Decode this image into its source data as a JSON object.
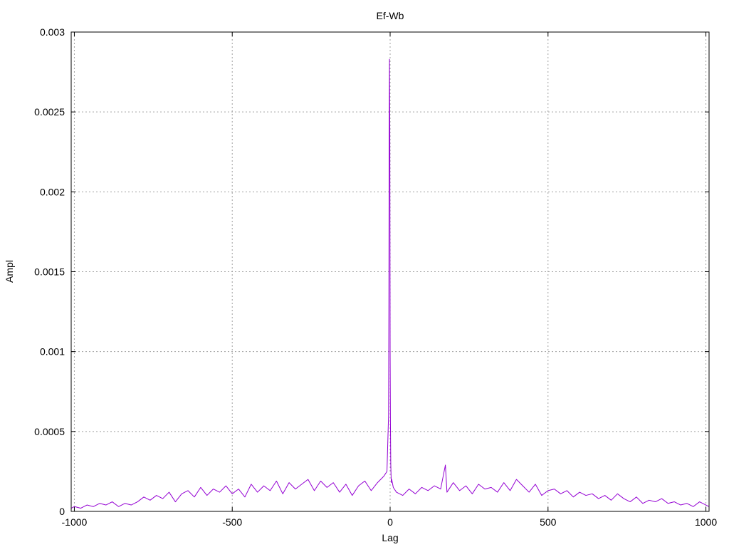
{
  "chart_data": {
    "type": "line",
    "title": "Ef-Wb",
    "xlabel": "Lag",
    "ylabel": "Ampl",
    "xlim": [
      -1010,
      1010
    ],
    "ylim": [
      0,
      0.003
    ],
    "x_ticks": [
      -1000,
      -500,
      0,
      500,
      1000
    ],
    "x_tick_labels": [
      "-1000",
      "-500",
      "0",
      "500",
      "1000"
    ],
    "y_ticks": [
      0,
      0.0005,
      0.001,
      0.0015,
      0.002,
      0.0025,
      0.003
    ],
    "y_tick_labels": [
      "0",
      "0.0005",
      "0.001",
      "0.0015",
      "0.002",
      "0.0025",
      "0.003"
    ],
    "grid": true,
    "series": [
      {
        "color": "#9400d3",
        "x": [
          -1010,
          -1000,
          -980,
          -960,
          -940,
          -920,
          -900,
          -880,
          -860,
          -840,
          -820,
          -800,
          -780,
          -760,
          -740,
          -720,
          -700,
          -680,
          -660,
          -640,
          -620,
          -600,
          -580,
          -560,
          -540,
          -520,
          -500,
          -480,
          -460,
          -440,
          -420,
          -400,
          -380,
          -360,
          -340,
          -320,
          -300,
          -280,
          -260,
          -240,
          -220,
          -200,
          -180,
          -160,
          -140,
          -120,
          -100,
          -80,
          -60,
          -40,
          -20,
          -10,
          -5,
          -4,
          -3,
          -2,
          -1,
          0,
          1,
          2,
          3,
          4,
          5,
          10,
          20,
          40,
          60,
          80,
          100,
          120,
          140,
          160,
          175,
          180,
          200,
          220,
          240,
          260,
          280,
          300,
          320,
          340,
          360,
          380,
          400,
          420,
          440,
          460,
          480,
          500,
          520,
          540,
          560,
          580,
          600,
          620,
          640,
          660,
          680,
          700,
          720,
          740,
          760,
          780,
          800,
          820,
          840,
          860,
          880,
          900,
          920,
          940,
          960,
          980,
          1000,
          1010
        ],
        "y": [
          2e-05,
          3e-05,
          2e-05,
          4e-05,
          3e-05,
          5e-05,
          4e-05,
          6e-05,
          3e-05,
          5e-05,
          4e-05,
          6e-05,
          9e-05,
          7e-05,
          0.0001,
          8e-05,
          0.00012,
          6e-05,
          0.00011,
          0.00013,
          9e-05,
          0.00015,
          0.0001,
          0.00014,
          0.00012,
          0.00016,
          0.00011,
          0.00014,
          9e-05,
          0.00017,
          0.00012,
          0.00016,
          0.00013,
          0.00019,
          0.00011,
          0.00018,
          0.00014,
          0.00017,
          0.0002,
          0.00013,
          0.00019,
          0.00015,
          0.00018,
          0.00012,
          0.00017,
          0.0001,
          0.00016,
          0.00019,
          0.00013,
          0.00018,
          0.00022,
          0.00025,
          0.0006,
          0.0013,
          0.00235,
          0.00283,
          0.0024,
          0.001,
          0.00055,
          0.0003,
          0.00022,
          0.00018,
          0.0002,
          0.00015,
          0.00012,
          0.0001,
          0.00014,
          0.00011,
          0.00015,
          0.00013,
          0.00016,
          0.00014,
          0.00029,
          0.00012,
          0.00018,
          0.00013,
          0.00016,
          0.00011,
          0.00017,
          0.00014,
          0.00015,
          0.00012,
          0.00018,
          0.00013,
          0.0002,
          0.00016,
          0.00012,
          0.00017,
          0.0001,
          0.00013,
          0.00014,
          0.00011,
          0.00013,
          9e-05,
          0.00012,
          0.0001,
          0.00011,
          8e-05,
          0.0001,
          7e-05,
          0.00011,
          8e-05,
          6e-05,
          9e-05,
          5e-05,
          7e-05,
          6e-05,
          8e-05,
          5e-05,
          6e-05,
          4e-05,
          5e-05,
          3e-05,
          6e-05,
          4e-05,
          3e-05
        ]
      }
    ]
  }
}
